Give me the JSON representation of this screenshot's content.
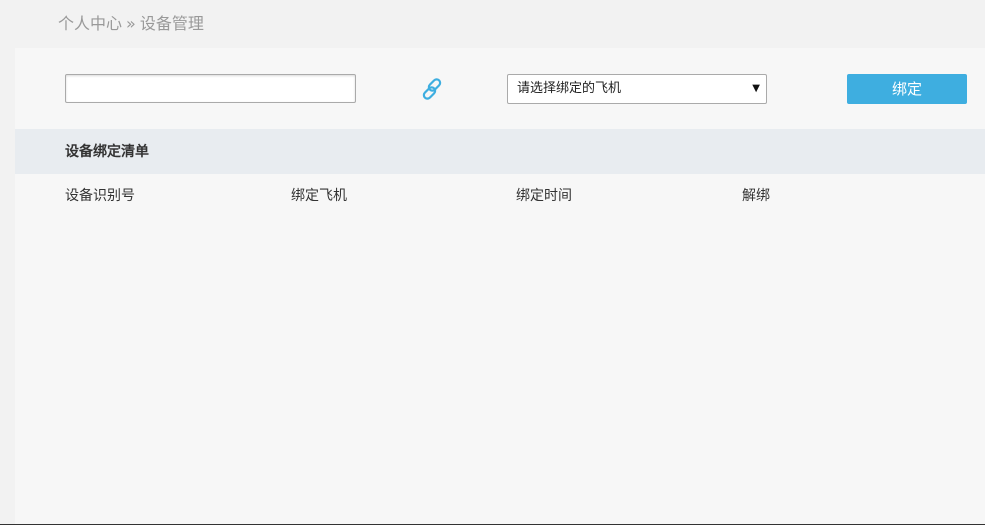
{
  "breadcrumb": {
    "home": "个人中心",
    "separator": "»",
    "current": "设备管理"
  },
  "form": {
    "device_input_value": "",
    "plane_select_value": "请选择绑定的飞机",
    "bind_button_label": "绑定"
  },
  "list": {
    "title": "设备绑定清单",
    "columns": [
      "设备识别号",
      "绑定飞机",
      "绑定时间",
      "解绑"
    ]
  },
  "colors": {
    "accent": "#3eaee0",
    "link_icon": "#3eaee0"
  },
  "icons": {
    "link": "link-icon",
    "dropdown": "chevron-down-icon"
  }
}
